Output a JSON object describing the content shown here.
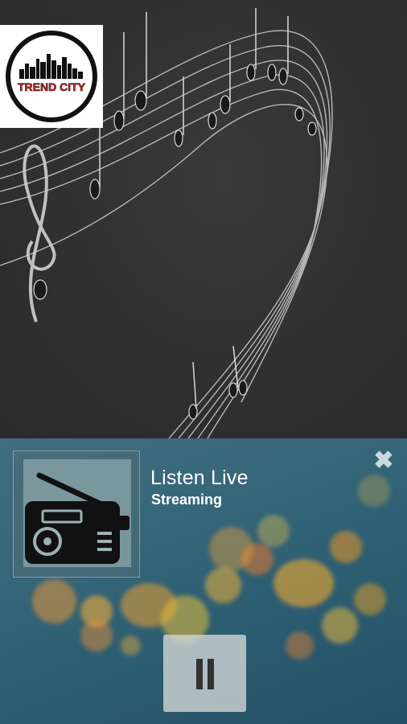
{
  "logo": {
    "brand_text": "TREND CITY",
    "accent_color": "#e02020",
    "ring_color": "#111111"
  },
  "background": {
    "motif": "music-staff-notes",
    "color": "#333333"
  },
  "player": {
    "title": "Listen Live",
    "subtitle": "Streaming",
    "artwork_icon": "radio-icon",
    "close_icon": "close-icon",
    "close_glyph": "✖",
    "control_icon": "pause-icon",
    "state": "playing"
  }
}
